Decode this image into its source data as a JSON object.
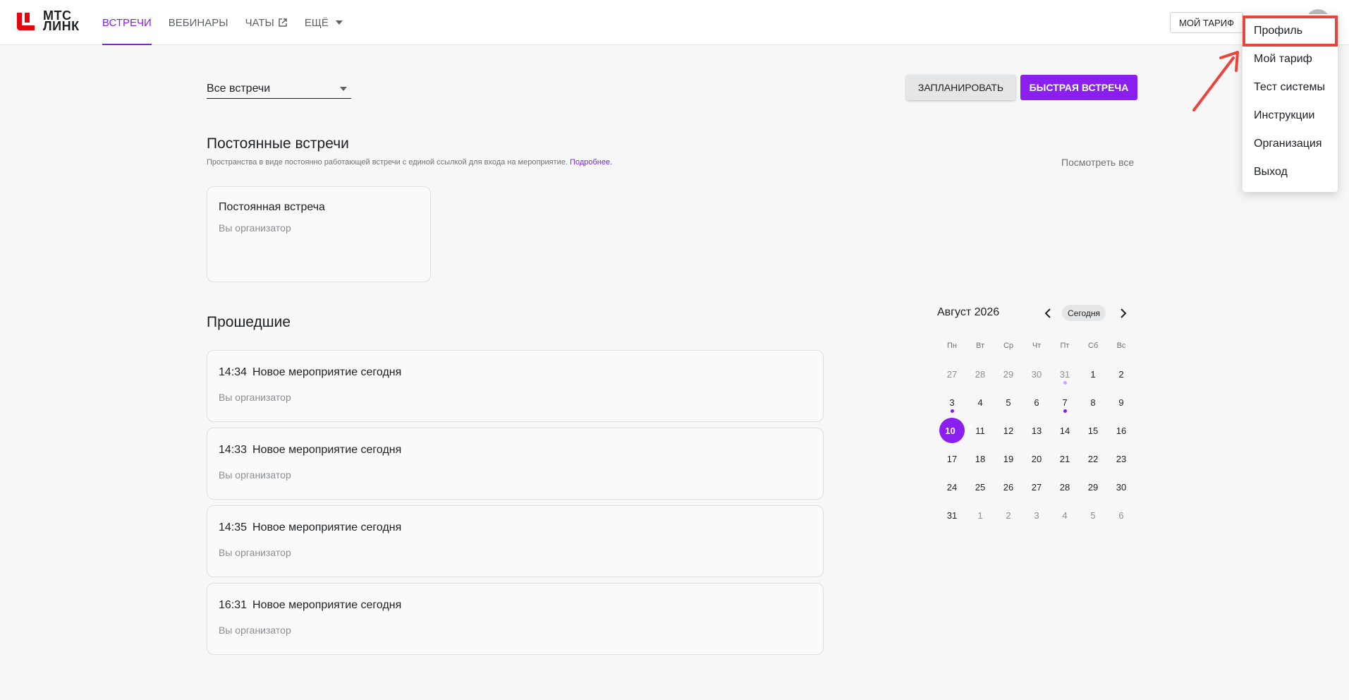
{
  "header": {
    "logo_line1": "МТС",
    "logo_line2": "ЛИНК",
    "nav": [
      {
        "label": "ВСТРЕЧИ"
      },
      {
        "label": "ВЕБИНАРЫ"
      },
      {
        "label": "ЧАТЫ"
      },
      {
        "label": "ЕЩЁ"
      }
    ],
    "tariff_label": "МОЙ ТАРИФ"
  },
  "user_menu": {
    "items": [
      {
        "label": "Профиль"
      },
      {
        "label": "Мой тариф"
      },
      {
        "label": "Тест системы"
      },
      {
        "label": "Инструкции"
      },
      {
        "label": "Организация"
      },
      {
        "label": "Выход"
      }
    ]
  },
  "toolbar": {
    "filter_value": "Все встречи",
    "plan_label": "ЗАПЛАНИРОВАТЬ",
    "fast_label": "БЫСТРАЯ ВСТРЕЧА"
  },
  "permanent": {
    "title": "Постоянные встречи",
    "description": "Пространства в виде постоянно работающей встречи с единой ссылкой для входа на мероприятие.",
    "more_link": "Подробнее.",
    "see_all": "Посмотреть все",
    "card": {
      "title": "Постоянная встреча",
      "role": "Вы организатор"
    }
  },
  "past": {
    "title": "Прошедшие",
    "events": [
      {
        "time": "14:34",
        "title": "Новое мероприятие сегодня",
        "role": "Вы организатор"
      },
      {
        "time": "14:33",
        "title": "Новое мероприятие сегодня",
        "role": "Вы организатор"
      },
      {
        "time": "14:35",
        "title": "Новое мероприятие сегодня",
        "role": "Вы организатор"
      },
      {
        "time": "16:31",
        "title": "Новое мероприятие сегодня",
        "role": "Вы организатор"
      }
    ]
  },
  "calendar": {
    "month_label": "Август 2026",
    "today_label": "Сегодня",
    "weekdays": [
      "Пн",
      "Вт",
      "Ср",
      "Чт",
      "Пт",
      "Сб",
      "Вс"
    ],
    "days": [
      {
        "n": "27",
        "m": true
      },
      {
        "n": "28",
        "m": true
      },
      {
        "n": "29",
        "m": true
      },
      {
        "n": "30",
        "m": true
      },
      {
        "n": "31",
        "m": true,
        "dot": "light"
      },
      {
        "n": "1"
      },
      {
        "n": "2"
      },
      {
        "n": "3",
        "dot": "dark"
      },
      {
        "n": "4"
      },
      {
        "n": "5"
      },
      {
        "n": "6"
      },
      {
        "n": "7",
        "dot": "dark"
      },
      {
        "n": "8"
      },
      {
        "n": "9"
      },
      {
        "n": "10",
        "sel": true,
        "dot": "dark"
      },
      {
        "n": "11"
      },
      {
        "n": "12"
      },
      {
        "n": "13"
      },
      {
        "n": "14"
      },
      {
        "n": "15"
      },
      {
        "n": "16"
      },
      {
        "n": "17"
      },
      {
        "n": "18"
      },
      {
        "n": "19"
      },
      {
        "n": "20"
      },
      {
        "n": "21"
      },
      {
        "n": "22"
      },
      {
        "n": "23"
      },
      {
        "n": "24"
      },
      {
        "n": "25"
      },
      {
        "n": "26"
      },
      {
        "n": "27"
      },
      {
        "n": "28"
      },
      {
        "n": "29"
      },
      {
        "n": "30"
      },
      {
        "n": "31"
      },
      {
        "n": "1",
        "m": true
      },
      {
        "n": "2",
        "m": true
      },
      {
        "n": "3",
        "m": true
      },
      {
        "n": "4",
        "m": true
      },
      {
        "n": "5",
        "m": true
      },
      {
        "n": "6",
        "m": true
      }
    ]
  },
  "colors": {
    "accent": "#7e1ff0",
    "annotation": "#e8453c",
    "logo": "#e30611"
  },
  "icons": {
    "external": "external-link-icon",
    "caret": "chevron-down-icon",
    "prev": "chevron-left-icon",
    "next": "chevron-right-icon"
  }
}
